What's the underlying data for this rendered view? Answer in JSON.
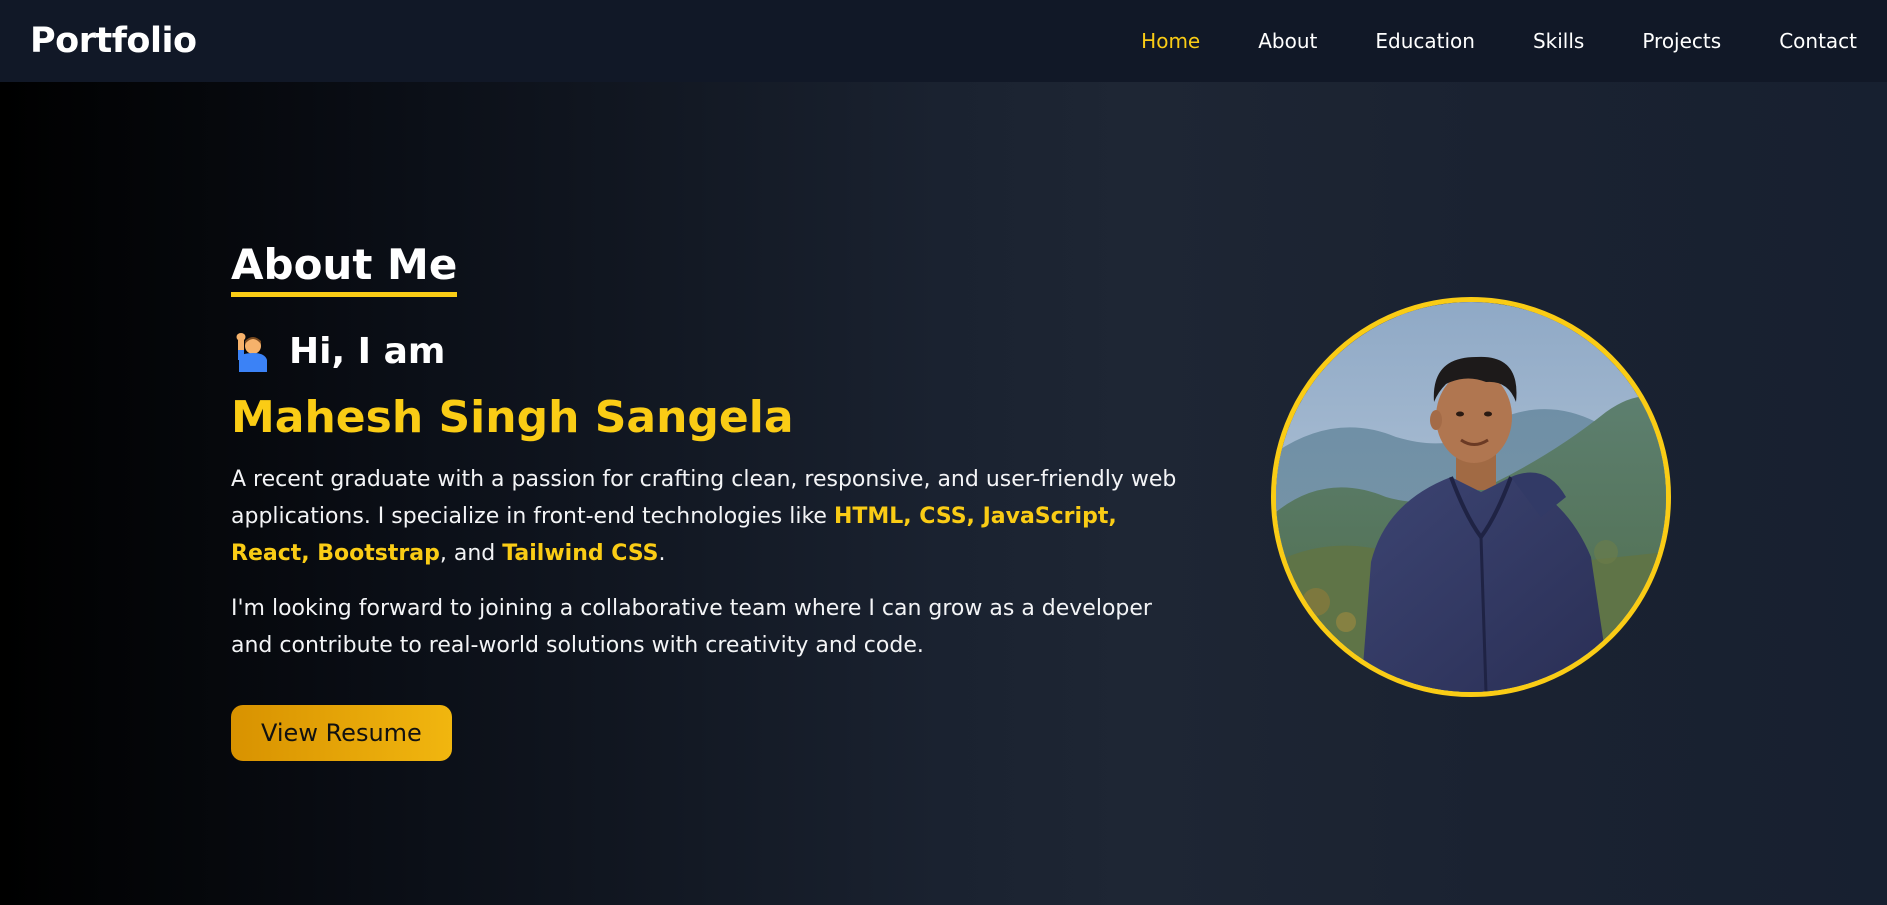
{
  "navbar": {
    "brand": "Portfolio",
    "links": [
      "Home",
      "About",
      "Education",
      "Skills",
      "Projects",
      "Contact"
    ],
    "active": "Home"
  },
  "about": {
    "title": "About Me",
    "greeting": "Hi, I am",
    "greeting_icon": "raising-hand-emoji",
    "name": "Mahesh Singh Sangela",
    "para1": {
      "text_before": "A recent graduate with a passion for crafting clean, responsive, and user-friendly web applications. I specialize in front-end technologies like ",
      "highlight_1": "HTML, CSS, JavaScript, React, Bootstrap",
      "text_mid": ", and ",
      "highlight_2": "Tailwind CSS",
      "text_end": "."
    },
    "para2": "I'm looking forward to joining a collaborative team where I can grow as a developer and contribute to real-world solutions with creativity and code.",
    "resume_button": "View Resume"
  },
  "colors": {
    "accent": "#facc15",
    "nav_bg": "#111827",
    "button_gradient": [
      "#d89200",
      "#f1b60f"
    ]
  }
}
